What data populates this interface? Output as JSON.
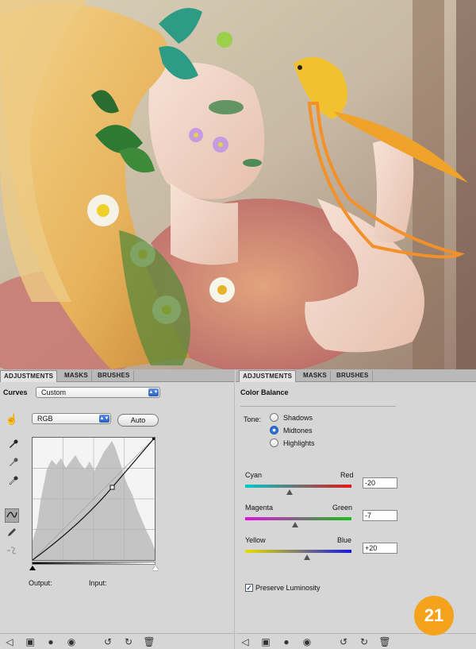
{
  "left_panel": {
    "tabs": [
      {
        "label": "ADJUSTMENTS",
        "active": true
      },
      {
        "label": "MASKS",
        "active": false
      },
      {
        "label": "BRUSHES",
        "active": false
      }
    ],
    "adjustment_name": "Curves",
    "preset_value": "Custom",
    "channel_value": "RGB",
    "auto_label": "Auto",
    "output_label": "Output:",
    "input_label": "Input:",
    "tool_icons": [
      "on-image-adjust-icon",
      "black-point-eyedropper-icon",
      "gray-point-eyedropper-icon",
      "white-point-eyedropper-icon",
      "curve-points-icon",
      "pencil-icon",
      "smooth-curve-icon"
    ],
    "footer_icons": [
      "back-icon",
      "layer-view-icon",
      "clip-to-layer-icon",
      "visibility-eye-icon",
      "view-previous-icon",
      "reset-icon",
      "delete-icon"
    ]
  },
  "right_panel": {
    "tabs": [
      {
        "label": "ADJUSTMENTS",
        "active": true
      },
      {
        "label": "MASKS",
        "active": false
      },
      {
        "label": "BRUSHES",
        "active": false
      }
    ],
    "adjustment_name": "Color Balance",
    "tone_label": "Tone:",
    "tone_options": [
      {
        "label": "Shadows",
        "selected": false
      },
      {
        "label": "Midtones",
        "selected": true
      },
      {
        "label": "Highlights",
        "selected": false
      }
    ],
    "sliders": [
      {
        "left": "Cyan",
        "right": "Red",
        "value": "-20",
        "position": 0.42,
        "colors": [
          "#00c8c8",
          "#e01818"
        ]
      },
      {
        "left": "Magenta",
        "right": "Green",
        "value": "-7",
        "position": 0.47,
        "colors": [
          "#e010e0",
          "#18c018"
        ]
      },
      {
        "left": "Yellow",
        "right": "Blue",
        "value": "+20",
        "position": 0.58,
        "colors": [
          "#e8e000",
          "#1818e0"
        ]
      }
    ],
    "preserve_luminosity_label": "Preserve Luminosity",
    "preserve_luminosity_checked": true,
    "footer_icons": [
      "back-icon",
      "layer-view-icon",
      "clip-to-layer-icon",
      "visibility-eye-icon",
      "view-previous-icon",
      "reset-icon",
      "delete-icon"
    ]
  },
  "step_badge": "21",
  "colors": {
    "badge": "#f5a21c",
    "panel_bg": "#d6d6d6",
    "accent_blue": "#2a6fd8"
  }
}
